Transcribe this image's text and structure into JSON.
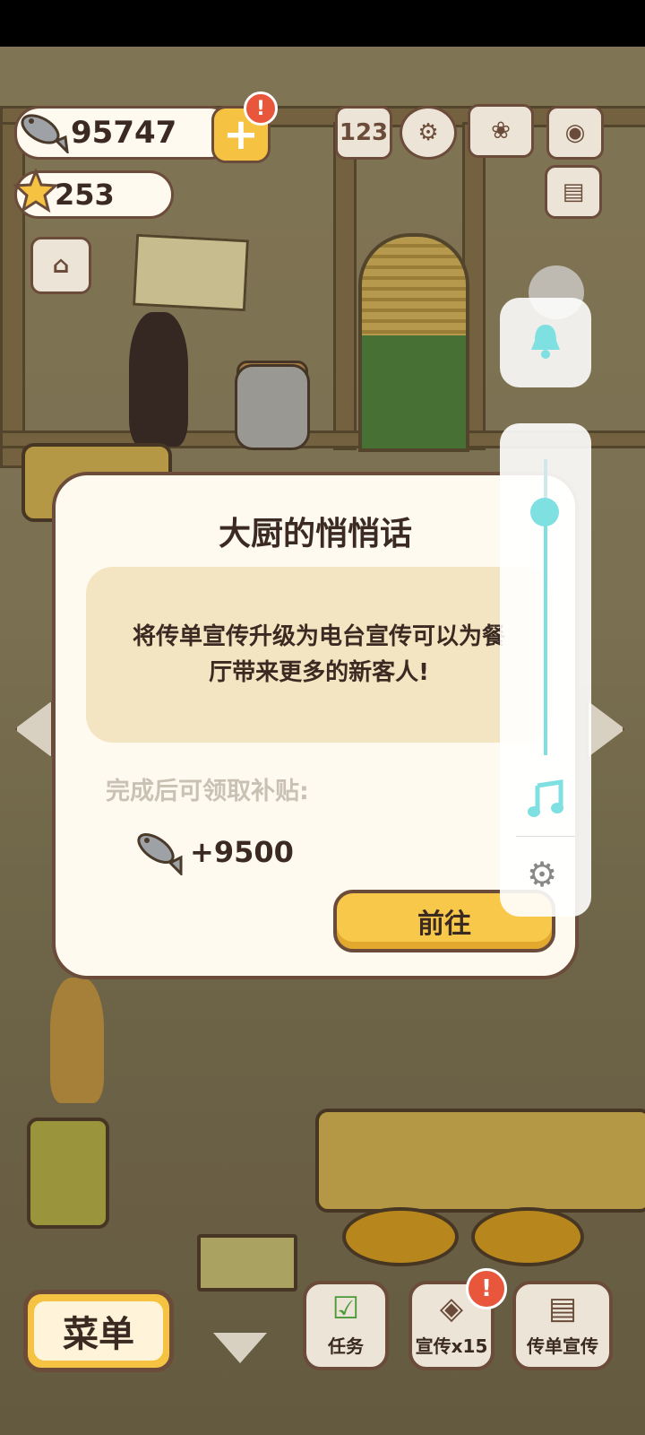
{
  "hud": {
    "fish_count": "95747",
    "star_count": "253",
    "add_label": "+",
    "alert_mark": "!"
  },
  "top_icons": [
    "ranking-icon",
    "settings-gear-icon",
    "recipe-book-icon",
    "camera-icon",
    "newspaper-icon"
  ],
  "dialog": {
    "title": "大厨的悄悄话",
    "tip_line1": "将传单宣传升级为电台宣传可以为餐",
    "tip_line2": "厅带来更多的新客人!",
    "reward_label": "完成后可领取补贴:",
    "reward_amount": "+9500",
    "go_button": "前往"
  },
  "volume_overlay": {
    "level": 0.82,
    "accent_color": "#7ee0e0",
    "icons": [
      "bell-icon",
      "music-note-icon",
      "gear-icon"
    ]
  },
  "bottom_bar": {
    "menu": "菜单",
    "tasks": "任务",
    "promo": "宣传x15",
    "flyer": "传单宣传",
    "alert_mark": "!"
  },
  "colors": {
    "panel_bg": "#fffaf0",
    "tip_bg": "#f3e4c2",
    "button_yellow": "#f8c84a",
    "outline": "#6b4b3a",
    "alert_red": "#e8563c"
  }
}
